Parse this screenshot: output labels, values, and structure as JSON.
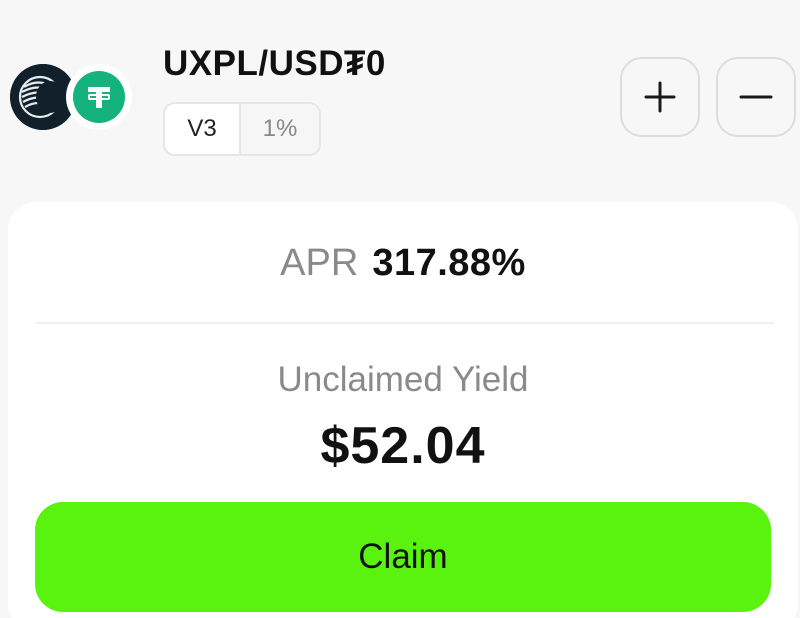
{
  "header": {
    "pair": "UXPL/USD₮0",
    "version": "V3",
    "fee": "1%",
    "icons": {
      "token_a": "uxpl-token-icon",
      "token_b": "usdt0-token-icon",
      "add": "plus-icon",
      "remove": "minus-icon"
    }
  },
  "stats": {
    "apr_label": "APR",
    "apr_value": "317.88%",
    "yield_label": "Unclaimed Yield",
    "yield_value": "$52.04"
  },
  "actions": {
    "claim_label": "Claim"
  },
  "colors": {
    "claim_button": "#5af20f",
    "usdt_token": "#14b37d",
    "uxpl_token": "#11202a"
  }
}
